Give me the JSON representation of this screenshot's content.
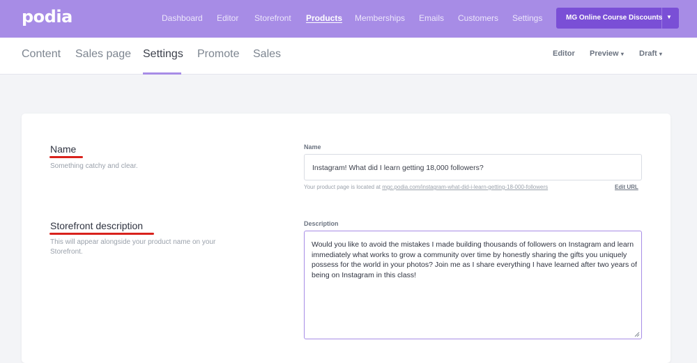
{
  "topbar": {
    "logo": "podia",
    "nav": [
      "Dashboard",
      "Editor",
      "Storefront",
      "Products",
      "Memberships",
      "Emails",
      "Customers",
      "Settings"
    ],
    "active": "Products",
    "school_button": "MG Online Course Discounts",
    "bg_color": "#a78ce6",
    "button_color": "#7a4fd6"
  },
  "subnav": {
    "tabs": [
      "Content",
      "Sales page",
      "Settings",
      "Promote",
      "Sales"
    ],
    "active_tab": "Settings",
    "editor_link": "Editor",
    "preview_link": "Preview",
    "status_link": "Draft"
  },
  "name_section": {
    "title": "Name",
    "description": "Something catchy and clear.",
    "field_label": "Name",
    "value": "Instagram! What did I learn getting 18,000 followers?",
    "url_prefix": "Your product page is located at",
    "url": "mgc.podia.com/instagram-what-did-i-learn-getting-18-000-followers",
    "edit_url": "Edit URL"
  },
  "description_section": {
    "title": "Storefront description",
    "description": "This will appear alongside your product name on your Storefront.",
    "field_label": "Description",
    "value": "Would you like to avoid the mistakes I made building thousands of followers on Instagram and learn immediately what works to grow a community over time by honestly sharing the gifts you uniquely possess for the world in your photos?  Join me as I share everything I have learned after two years of being on Instagram in this class!"
  },
  "annotation_color": "#d9221c"
}
